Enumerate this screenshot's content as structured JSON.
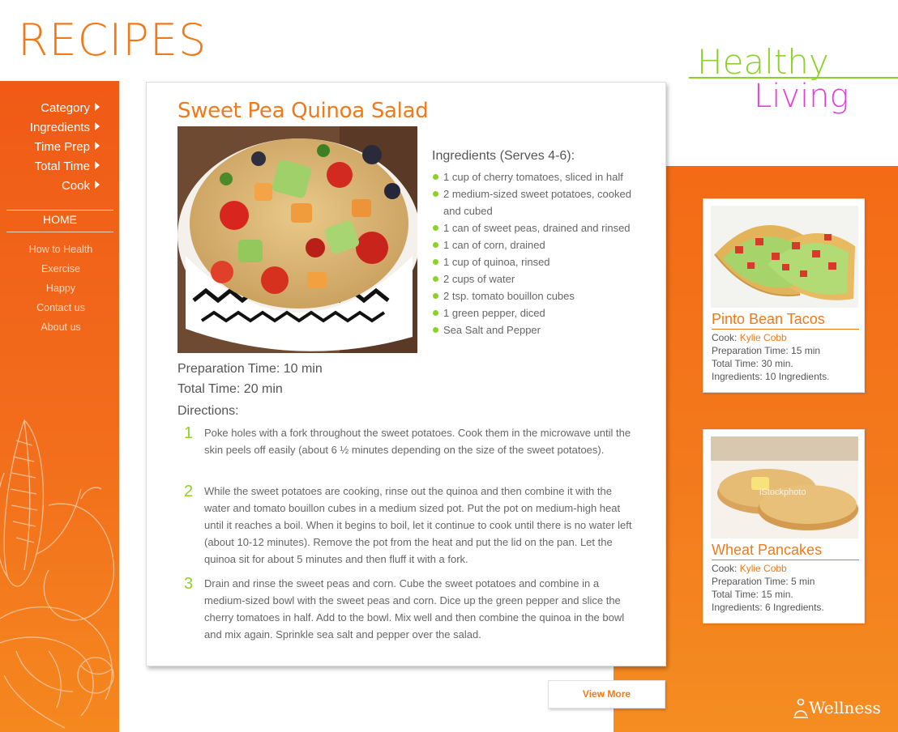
{
  "header": {
    "title": "RECIPES",
    "tagline_top": "Healthy",
    "tagline_bottom": "Living"
  },
  "sidebar": {
    "filters": [
      {
        "label": "Category"
      },
      {
        "label": "Ingredients"
      },
      {
        "label": "Time Prep"
      },
      {
        "label": "Total Time"
      },
      {
        "label": "Cook"
      }
    ],
    "home_label": "HOME",
    "links": [
      {
        "label": "How to Health"
      },
      {
        "label": "Exercise"
      },
      {
        "label": "Happy"
      },
      {
        "label": "Contact us"
      },
      {
        "label": "About us"
      }
    ]
  },
  "recipe": {
    "title": "Sweet Pea Quinoa Salad",
    "ingredients_heading": "Ingredients (Serves 4-6):",
    "ingredients": [
      "1 cup of cherry tomatoes, sliced in half",
      "2 medium-sized sweet potatoes, cooked and cubed",
      "1 can of sweet peas, drained and rinsed",
      "1 can of corn, drained",
      "1 cup of quinoa, rinsed",
      "2 cups of water",
      "2 tsp. tomato bouillon cubes",
      "1 green pepper, diced",
      "Sea Salt and Pepper"
    ],
    "prep_time": "Preparation Time: 10 min",
    "total_time": "Total Time: 20 min",
    "directions_heading": "Directions:",
    "steps": [
      {
        "num": "1",
        "text": "Poke holes with a fork throughout the sweet potatoes.  Cook them in the microwave until the skin peels off easily (about 6 ½ minutes depending on the size of the sweet potatoes)."
      },
      {
        "num": "2",
        "text": "While the sweet potatoes are cooking, rinse out the quinoa and then combine it with the water and tomato bouillon cubes in a medium sized pot.  Put the pot on medium-high heat until it reaches a boil.  When it begins to boil, let it continue to cook until there is no water left (about 10-12 minutes).  Remove the pot from the heat and put the lid on the pan.  Let the quinoa sit for about 5 minutes and then fluff it with a fork."
      },
      {
        "num": "3",
        "text": "Drain and rinse the sweet peas and corn.   Cube the sweet potatoes and combine in a medium-sized bowl with the sweet peas and corn.  Dice up the green pepper and slice the cherry tomatoes in half.   Add to the bowl.  Mix well and then combine the quinoa in the bowl and mix again.  Sprinkle sea salt and pepper over the salad."
      }
    ]
  },
  "side_recipes": [
    {
      "title": "Pinto Bean Tacos",
      "cook_label": "Cook:",
      "cook_name": "Kylie Cobb",
      "prep": "Preparation Time: 15 min",
      "total": "Total Time: 30 min.",
      "ingredients": "Ingredients: 10 Ingredients."
    },
    {
      "title": "Wheat Pancakes",
      "cook_label": "Cook:",
      "cook_name": "Kylie Cobb",
      "prep": "Preparation Time: 5 min",
      "total": "Total Time: 15 min.",
      "ingredients": "Ingredients: 6 Ingredients.",
      "watermark": "iStockphoto"
    }
  ],
  "view_more_label": "View More",
  "footer": {
    "logo_text": "Wellness"
  },
  "colors": {
    "accent_orange": "#f07a1a",
    "sidebar_orange": "#f05a16",
    "healthy_green": "#8cd12a",
    "living_magenta": "#e23fd6"
  }
}
